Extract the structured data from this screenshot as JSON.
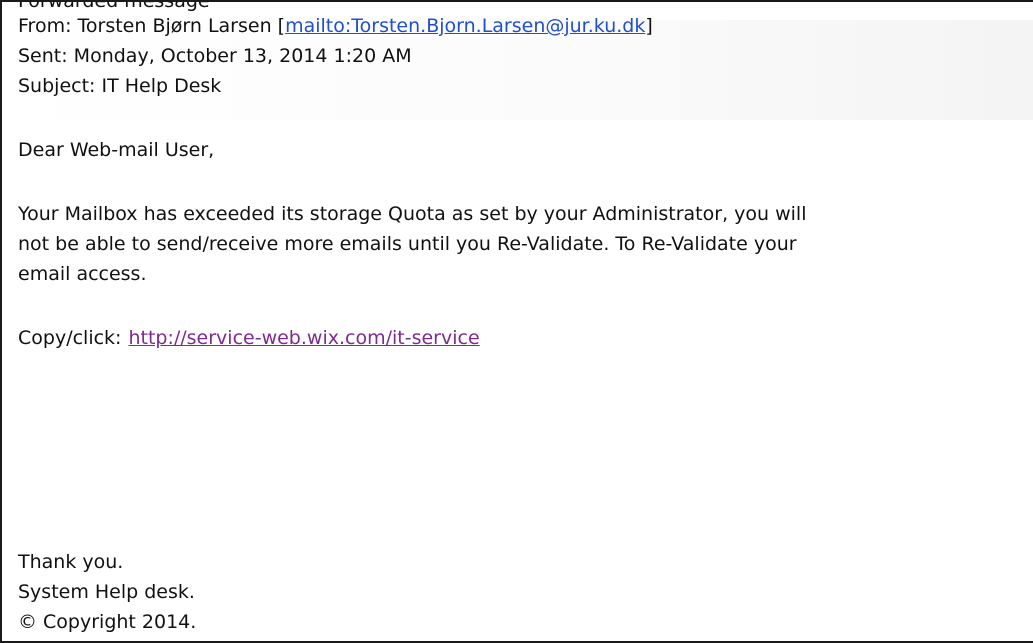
{
  "email": {
    "cropped_top_text": "Forwarded message",
    "from": {
      "label": "From: Torsten Bjørn Larsen [",
      "mailto": "mailto:Torsten.Bjorn.Larsen@jur.ku.dk",
      "suffix": "]"
    },
    "sent": "Sent: Monday, October 13, 2014 1:20 AM",
    "subject": "Subject: IT Help Desk",
    "greeting": "Dear Web-mail User,",
    "body_lines": [
      "Your Mailbox has exceeded its storage Quota as set by your Administrator, you will",
      "not be able to send/receive more emails until you Re-Validate. To Re-Validate your",
      "email access."
    ],
    "copy_click_label": "Copy/click:",
    "link_text": "http://service-web.wix.com/it-service",
    "closing": {
      "thanks": "Thank you.",
      "signature": "System Help desk.",
      "copyright": "© Copyright 2014."
    }
  }
}
